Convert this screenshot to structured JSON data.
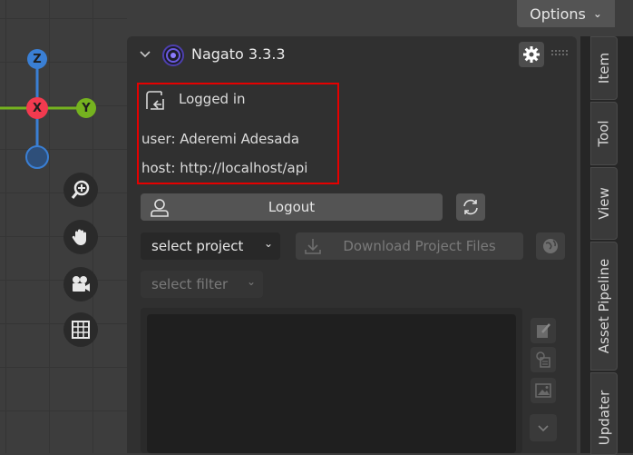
{
  "header": {
    "options_label": "Options"
  },
  "gizmo": {
    "z_label": "Z",
    "x_label": "X",
    "y_label": "Y"
  },
  "addon": {
    "title": "Nagato 3.3.3",
    "status": "Logged in",
    "user": "user: Aderemi Adesada",
    "host": "host: http://localhost/api",
    "logout_label": "Logout",
    "project_select": "select project",
    "download_label": "Download Project Files",
    "filter_select": "select filter"
  },
  "sidebar_tabs": [
    {
      "label": "Item"
    },
    {
      "label": "Tool"
    },
    {
      "label": "View"
    },
    {
      "label": "Asset Pipeline"
    },
    {
      "label": "Updater"
    }
  ],
  "colors": {
    "gizmo_x": "#f23a4f",
    "gizmo_y": "#75b21f",
    "gizmo_z": "#3a7fd4",
    "highlight": "#e50000"
  }
}
